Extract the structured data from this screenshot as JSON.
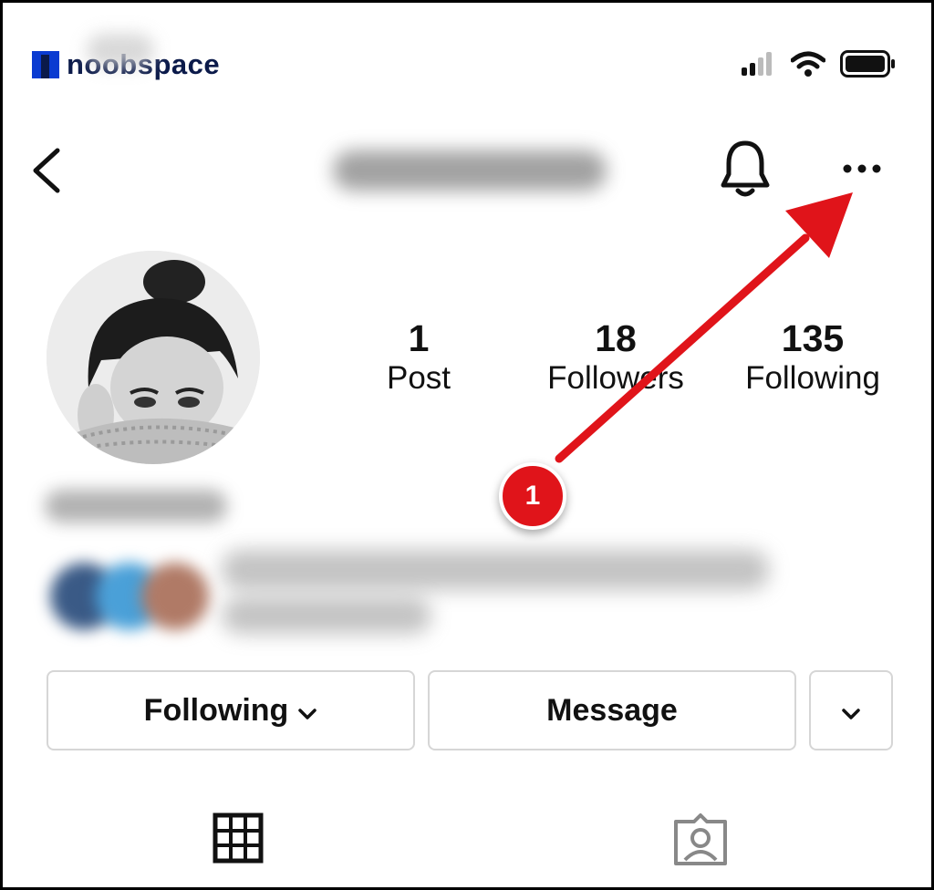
{
  "status_bar": {
    "brand": "noobspace",
    "icons": [
      "signal-icon",
      "wifi-icon",
      "battery-icon"
    ]
  },
  "nav": {
    "back_icon": "chevron-left-icon",
    "bell_icon": "bell-icon",
    "more_icon": "more-horizontal-icon"
  },
  "profile": {
    "stats": [
      {
        "value": "1",
        "label": "Post"
      },
      {
        "value": "18",
        "label": "Followers"
      },
      {
        "value": "135",
        "label": "Following"
      }
    ]
  },
  "actions": {
    "following_label": "Following",
    "message_label": "Message"
  },
  "tabs": {
    "grid_icon": "grid-icon",
    "tagged_icon": "tagged-user-icon"
  },
  "annotation": {
    "step": "1",
    "color": "#e0141a"
  }
}
